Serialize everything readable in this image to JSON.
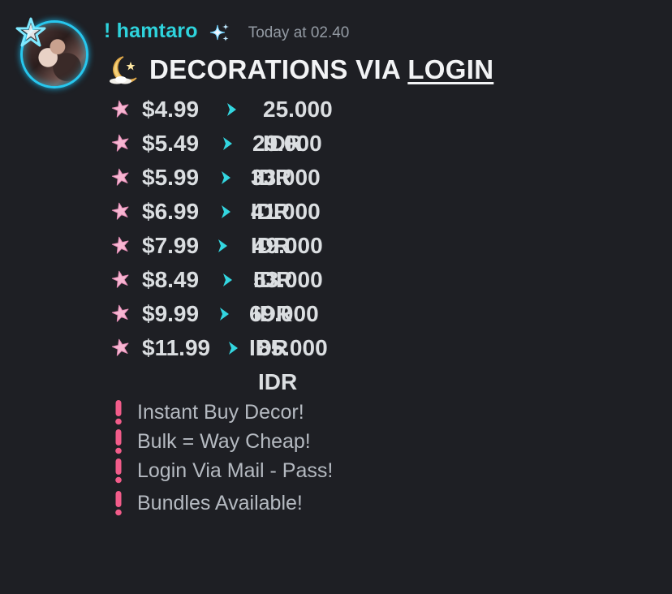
{
  "message": {
    "username": "! hamtaro",
    "timestamp": "Today at 02.40",
    "title_prefix": "DECORATIONS VIA ",
    "title_link": "LOGIN",
    "prices": [
      {
        "usd": "$4.99",
        "idr": "25.000 IDR"
      },
      {
        "usd": "$5.49",
        "idr": "29.000 IDR"
      },
      {
        "usd": "$5.99",
        "idr": "33.000 IDR"
      },
      {
        "usd": "$6.99",
        "idr": "41.000 IDR"
      },
      {
        "usd": "$7.99",
        "idr": "49.000 IDR"
      },
      {
        "usd": "$8.49",
        "idr": "53.000 IDR"
      },
      {
        "usd": "$9.99",
        "idr": "69.000 IDR"
      },
      {
        "usd": "$11.99",
        "idr": "85.000 IDR"
      }
    ],
    "notes": [
      "Instant Buy Decor!",
      "Bulk = Way Cheap!",
      "Login Via Mail - Pass!",
      "Bundles Available!"
    ]
  },
  "icons": {
    "avatar_decoration": "blue-star-decoration-icon",
    "username_badge": "sparkle-icon",
    "title_emoji": "crescent-moon-icon",
    "row_bullet": "pink-star-icon",
    "row_separator": "chevron-right-icon",
    "note_bullet": "exclamation-icon"
  },
  "colors": {
    "background": "#1e1f24",
    "username": "#2ed3dc",
    "timestamp": "#949ba4",
    "title": "#f2f3f5",
    "text": "#dbdee1",
    "notes": "#b5bac1",
    "star": "#f7b6d2",
    "chevron": "#33d6e0",
    "exclamation": "#f25c8a"
  }
}
